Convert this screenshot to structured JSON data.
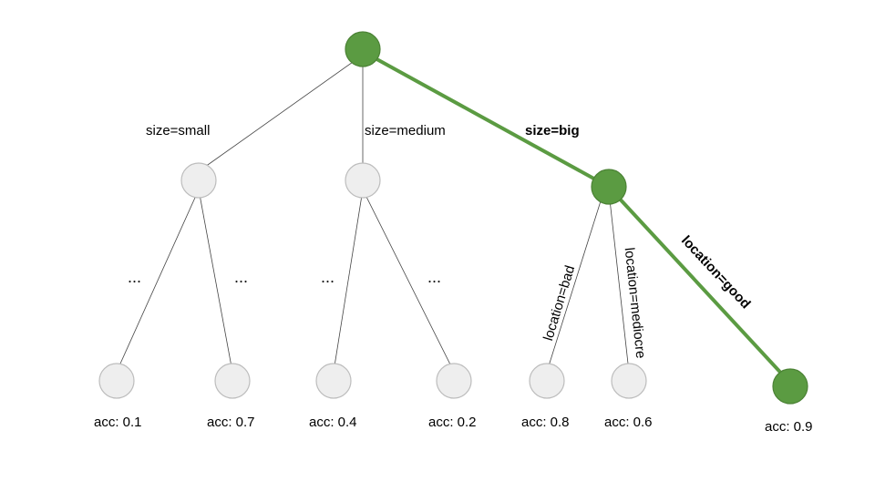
{
  "chart_data": {
    "type": "tree",
    "title": "",
    "split1": {
      "attribute": "size",
      "values": [
        "small",
        "medium",
        "big"
      ]
    },
    "split2_under_big": {
      "attribute": "location",
      "values": [
        "bad",
        "mediocre",
        "good"
      ]
    },
    "highlighted_path": [
      "size=big",
      "location=good"
    ],
    "leaves": [
      {
        "branch": "size=small / left",
        "acc": 0.1
      },
      {
        "branch": "size=small / right",
        "acc": 0.7
      },
      {
        "branch": "size=medium / left",
        "acc": 0.4
      },
      {
        "branch": "size=medium / right",
        "acc": 0.2
      },
      {
        "branch": "size=big / location=bad",
        "acc": 0.8
      },
      {
        "branch": "size=big / location=mediocre",
        "acc": 0.6
      },
      {
        "branch": "size=big / location=good",
        "acc": 0.9
      }
    ]
  },
  "labels": {
    "size_small": "size=small",
    "size_medium": "size=medium",
    "size_big": "size=big",
    "loc_bad": "location=bad",
    "loc_med": "location=mediocre",
    "loc_good": "location=good",
    "dots": "..."
  },
  "acc": {
    "a1": "acc: 0.1",
    "a2": "acc: 0.7",
    "a3": "acc: 0.4",
    "a4": "acc: 0.2",
    "a5": "acc: 0.8",
    "a6": "acc: 0.6",
    "a7": "acc: 0.9"
  }
}
